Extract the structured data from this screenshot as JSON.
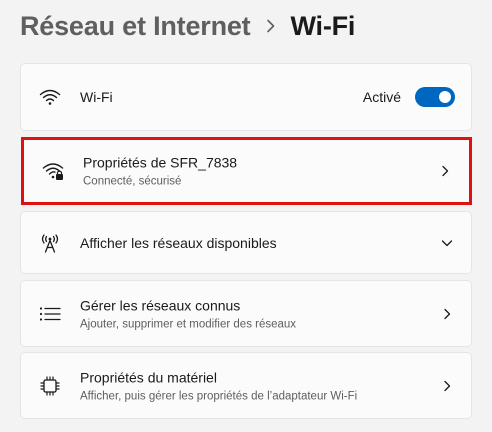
{
  "breadcrumb": {
    "parent": "Réseau et Internet",
    "separator_icon": "chevron-right-icon",
    "current": "Wi-Fi"
  },
  "wifi_toggle_row": {
    "icon": "wifi-icon",
    "label": "Wi-Fi",
    "state_label": "Activé",
    "toggle_on": true,
    "accent_color": "#0067c0"
  },
  "properties_row": {
    "icon": "wifi-lock-icon",
    "title": "Propriétés de SFR_7838",
    "subtitle": "Connecté, sécurisé",
    "chevron_icon": "chevron-right-icon",
    "highlight_color": "#e01010"
  },
  "available_networks_row": {
    "icon": "antenna-icon",
    "title": "Afficher les réseaux disponibles",
    "chevron_icon": "chevron-down-icon"
  },
  "known_networks_row": {
    "icon": "list-icon",
    "title": "Gérer les réseaux connus",
    "subtitle": "Ajouter, supprimer et modifier des réseaux",
    "chevron_icon": "chevron-right-icon"
  },
  "hardware_row": {
    "icon": "chip-icon",
    "title": "Propriétés du matériel",
    "subtitle": "Afficher, puis gérer les propriétés de l’adaptateur Wi-Fi",
    "chevron_icon": "chevron-right-icon"
  }
}
